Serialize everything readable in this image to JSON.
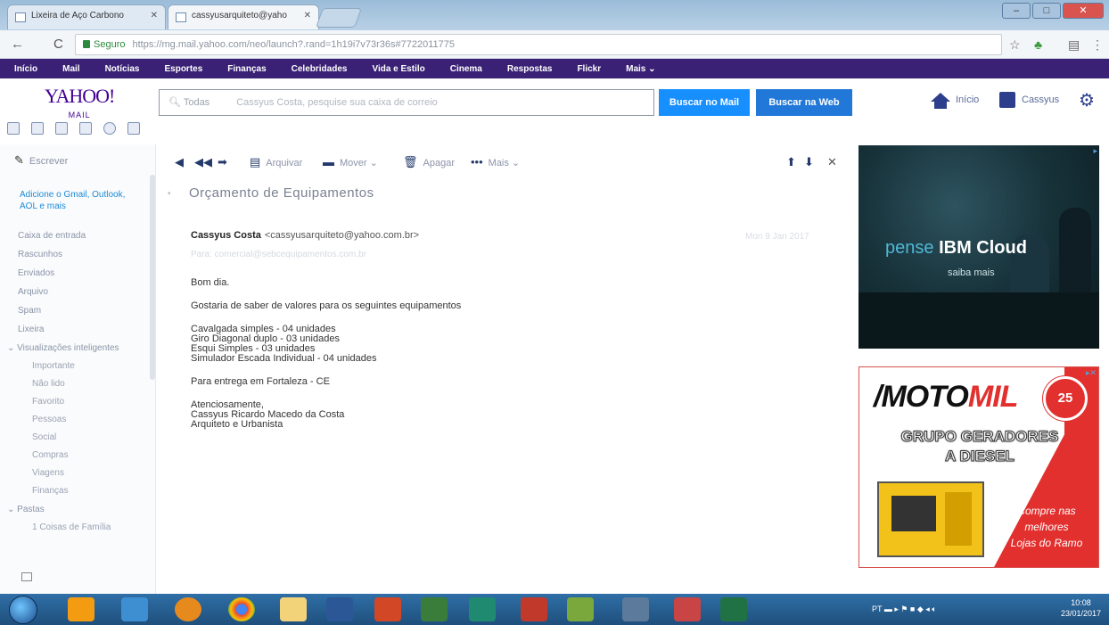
{
  "browser": {
    "tabs": [
      {
        "title": "Lixeira de Aço Carbono"
      },
      {
        "title": "cassyusarquiteto@yaho"
      }
    ],
    "secure_label": "Seguro",
    "url_host": "https://mg.mail.yahoo.com",
    "url_path": "/neo/launch?.rand=1h19i7v73r36s#7722011775"
  },
  "yahoo_nav": [
    "Início",
    "Mail",
    "Notícias",
    "Esportes",
    "Finanças",
    "Celebridades",
    "Vida e Estilo",
    "Cinema",
    "Respostas",
    "Flickr",
    "Mais ⌄"
  ],
  "header": {
    "logo": "YAHOO!",
    "logo_sub": "MAIL",
    "search_scope": "Todas",
    "search_placeholder": "Cassyus Costa, pesquise sua caixa de correio",
    "btn_search_mail": "Buscar no Mail",
    "btn_search_web": "Buscar na Web",
    "home_label": "Início",
    "user_label": "Cassyus"
  },
  "sidebar": {
    "compose": "Escrever",
    "add_accounts": "Adicione o Gmail, Outlook, AOL e mais",
    "folders": [
      "Caixa de entrada",
      "Rascunhos",
      "Enviados",
      "Arquivo",
      "Spam",
      "Lixeira"
    ],
    "smart_views_label": "Visualizações inteligentes",
    "smart_views": [
      "Importante",
      "Não lido",
      "Favorito",
      "Pessoas",
      "Social",
      "Compras",
      "Viagens",
      "Finanças"
    ],
    "pastas_label": "Pastas",
    "pastas": [
      "1 Coisas de Família"
    ]
  },
  "toolbar": {
    "archive": "Arquivar",
    "move": "Mover ⌄",
    "delete": "Apagar",
    "more": "Mais ⌄"
  },
  "message": {
    "subject": "Orçamento de Equipamentos",
    "sender_name": "Cassyus Costa",
    "sender_email": "<cassyusarquiteto@yahoo.com.br>",
    "date": "Mon 9 Jan 2017",
    "recipient": "Para: comercial@sebcequipamentos.com.br",
    "body": {
      "greeting": "Bom dia.",
      "intro": "Gostaria de saber de valores para os seguintes equipamentos",
      "items": [
        "Cavalgada simples - 04 unidades",
        "Giro Diagonal duplo - 03 unidades",
        "Esqui Simples - 03 unidades",
        "Simulador Escada Individual - 04 unidades"
      ],
      "delivery": "Para entrega em Fortaleza - CE",
      "closing": "Atenciosamente,",
      "signature_name": "Cassyus Ricardo Macedo da Costa",
      "signature_title": "Arquiteto e Urbanista"
    }
  },
  "ads": {
    "ibm_pense": "pense",
    "ibm_brand": "IBM Cloud",
    "ibm_sub": "saiba mais",
    "motomil_a": "/MOTO",
    "motomil_b": "MIL",
    "motomil_badge": "25",
    "motomil_line1": "GRUPO GERADORES",
    "motomil_line2": "A DIESEL",
    "motomil_cta1": "Compre nas",
    "motomil_cta2": "melhores",
    "motomil_cta3": "Lojas do Ramo"
  },
  "taskbar": {
    "tray": "PT",
    "time": "10:08",
    "date": "23/01/2017"
  },
  "colors": {
    "yahoo_purple": "#3a2175",
    "search_blue": "#188fff",
    "taskbar_blue": "#2f6fa7"
  }
}
